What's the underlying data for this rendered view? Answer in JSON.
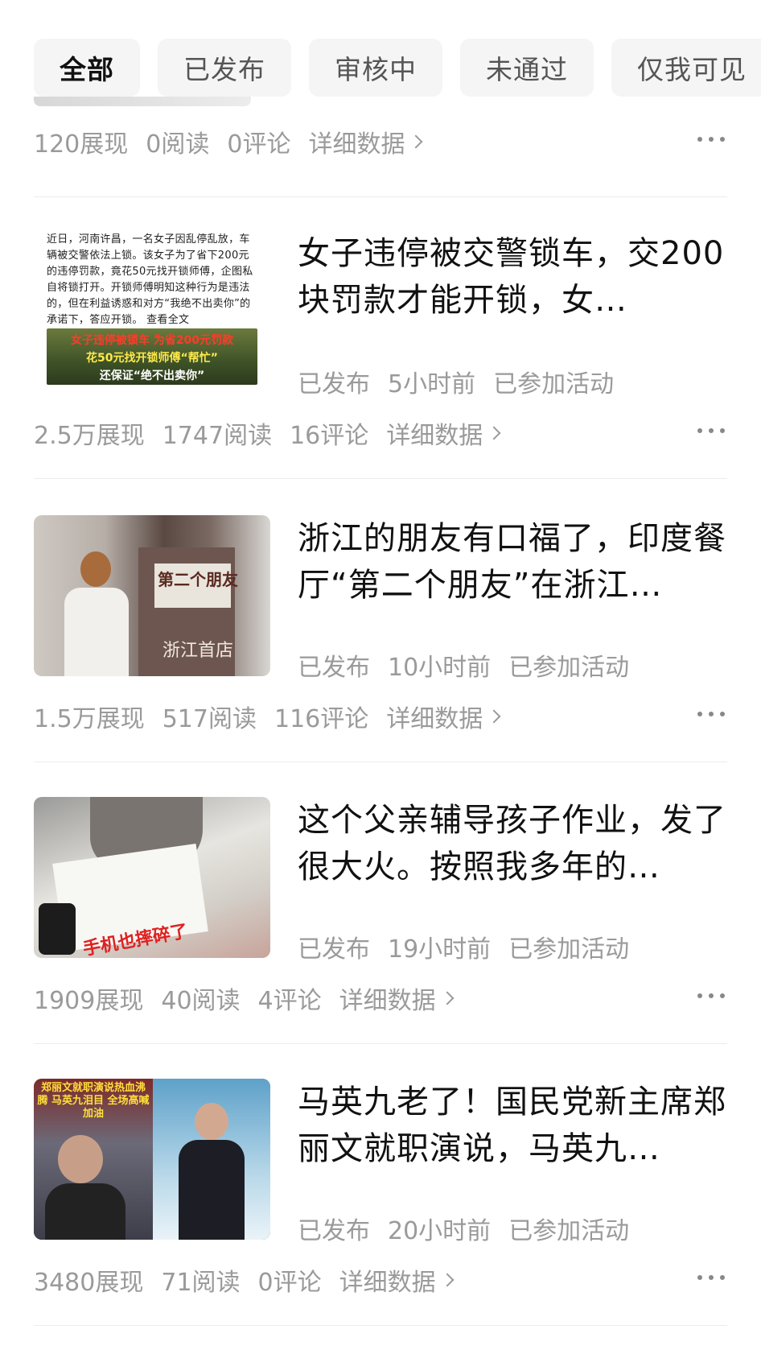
{
  "tabs": [
    {
      "label": "全部",
      "active": true
    },
    {
      "label": "已发布",
      "active": false
    },
    {
      "label": "审核中",
      "active": false
    },
    {
      "label": "未通过",
      "active": false
    },
    {
      "label": "仅我可见",
      "active": false
    }
  ],
  "first_partial_stats": {
    "impressions": "120展现",
    "reads": "0阅读",
    "comments": "0评论",
    "detail": "详细数据"
  },
  "articles": [
    {
      "title": "女子违停被交警锁车，交200块罚款才能开锁，女…",
      "status": "已发布",
      "time": "5小时前",
      "activity": "已参加活动",
      "impressions": "2.5万展现",
      "reads": "1747阅读",
      "comments": "16评论",
      "detail": "详细数据",
      "thumb_text": "近日，河南许昌，一名女子因乱停乱放，车辆被交警依法上锁。该女子为了省下200元的违停罚款，竟花50元找开锁师傅，企图私自将锁打开。开锁师傅明知这种行为是违法的，但在利益诱惑和对方“我绝不出卖你”的承诺下，答应开锁。 查看全文",
      "thumb_banner": [
        "女子违停被锁车 为省200元罚款",
        "花50元找开锁师傅“帮忙”",
        "还保证“绝不出卖你”"
      ]
    },
    {
      "title": "浙江的朋友有口福了，印度餐厅“第二个朋友”在浙江…",
      "status": "已发布",
      "time": "10小时前",
      "activity": "已参加活动",
      "impressions": "1.5万展现",
      "reads": "517阅读",
      "comments": "116评论",
      "detail": "详细数据",
      "thumb_sign": "第二个朋友",
      "thumb_store": "浙江首店"
    },
    {
      "title": "这个父亲辅导孩子作业，发了很大火。按照我多年的…",
      "status": "已发布",
      "time": "19小时前",
      "activity": "已参加活动",
      "impressions": "1909展现",
      "reads": "40阅读",
      "comments": "4评论",
      "detail": "详细数据",
      "thumb_caption": "手机也摔碎了"
    },
    {
      "title": "马英九老了！国民党新主席郑丽文就职演说，马英九…",
      "status": "已发布",
      "time": "20小时前",
      "activity": "已参加活动",
      "impressions": "3480展现",
      "reads": "71阅读",
      "comments": "0评论",
      "detail": "详细数据",
      "thumb_caption": "郑丽文就职演说热血沸腾 马英九泪目 全场高喊加油"
    }
  ]
}
